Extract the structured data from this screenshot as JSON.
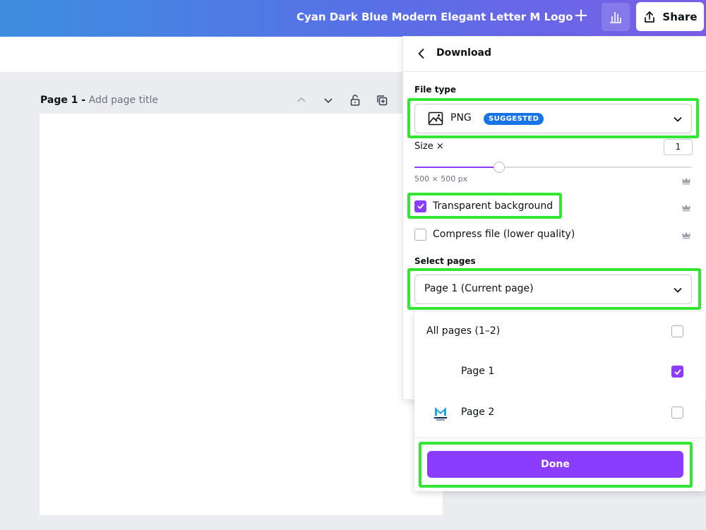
{
  "header": {
    "doc_title": "Cyan Dark Blue Modern Elegant Letter M Logo",
    "share_label": "Share",
    "plus_icon": "plus-icon",
    "stats_icon": "bar-chart-icon",
    "share_icon": "share-upload-icon"
  },
  "canvas": {
    "page_number": "Page 1 -",
    "page_title_placeholder": "Add page title"
  },
  "download_panel": {
    "title": "Download",
    "file_type_label": "File type",
    "file_type_value": "PNG",
    "suggested_badge": "SUGGESTED",
    "size_label": "Size ×",
    "size_value": "1",
    "size_slider_value": 1,
    "size_slider_min": 0.125,
    "size_slider_max": 3,
    "dimensions": "500 × 500 px",
    "transparent_background": {
      "label": "Transparent background",
      "checked": true
    },
    "compress_file": {
      "label": "Compress file (lower quality)",
      "checked": false
    },
    "select_pages_label": "Select pages",
    "select_pages_value": "Page 1 (Current page)"
  },
  "pages_dropdown": {
    "items": [
      {
        "label": "All pages (1–2)",
        "checked": false
      },
      {
        "label": "Page 1",
        "checked": true
      },
      {
        "label": "Page 2",
        "checked": false
      }
    ],
    "done_label": "Done"
  },
  "colors": {
    "accent": "#8b3dff",
    "highlight": "#33e633",
    "badge": "#1774e6"
  }
}
